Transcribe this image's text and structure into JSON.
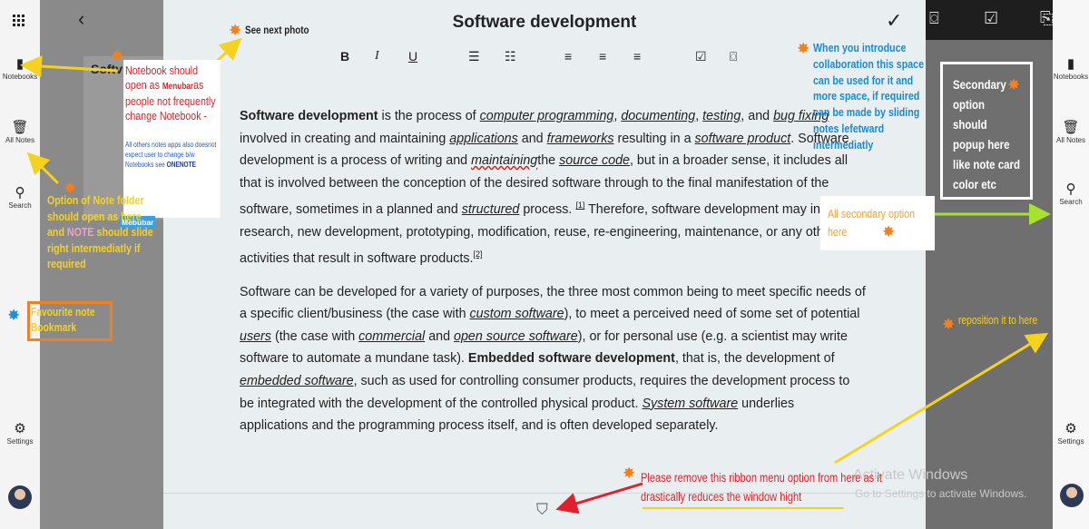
{
  "left_rail": {
    "items": [
      {
        "label": "Notebooks",
        "icon": "notebook-icon"
      },
      {
        "label": "All Notes",
        "icon": "trash-icon"
      },
      {
        "label": "Search",
        "icon": "search-icon"
      },
      {
        "label": "Settings",
        "icon": "gear-icon"
      }
    ]
  },
  "right_rail": {
    "items": [
      {
        "label": "Notebooks"
      },
      {
        "label": "All Notes"
      },
      {
        "label": "Search"
      },
      {
        "label": "Settings"
      }
    ]
  },
  "sidebar": {
    "partial_title": "Softv"
  },
  "editor": {
    "title": "Software development",
    "toolbar": [
      "B",
      "I",
      "U"
    ]
  },
  "content": {
    "p1": {
      "a": "Software development",
      "b": " is the process of ",
      "l1": "computer programming",
      "c": ", ",
      "l2": "documenting",
      "d": ", ",
      "l3": "testing",
      "e": ", and ",
      "l4": "bug fixing",
      "f": " involved in creating and maintaining ",
      "l5": "applications",
      "g": " and ",
      "l6": "frameworks",
      "h": " resulting in a ",
      "l7": "software product",
      "i": ". Software development is a process of writing and ",
      "l8": "maintaining",
      "j": "the ",
      "l9": "source code",
      "k": ", but in a broader sense, it includes all that is involved between the conception of the desired software through to the final manifestation of the software, sometimes in a planned and ",
      "l10": "structured",
      "m": " process. ",
      "ref1": "[1]",
      "n": " Therefore, software development may include research, new development, prototyping, modification, reuse, re-engineering, maintenance, or any other activities that result in software products.",
      "ref2": "[2]"
    },
    "p2": {
      "a": "Software can be developed for a variety of purposes, the three most common being to meet specific needs of a specific client/business (the case with ",
      "l1": "custom software",
      "b": "), to meet a perceived need of some set of potential ",
      "l2": "users",
      "c": " (the case with ",
      "l3": "commercial",
      "d": " and ",
      "l4": "open source software",
      "e": "), or for personal use (e.g. a scientist may write software to automate a mundane task). ",
      "bold": "Embedded software development",
      "f": ", that is, the development of ",
      "l5": "embedded software",
      "g": ", such as used for controlling consumer products, requires the development process to be integrated with the development of the controlled physical product. ",
      "l6": "System software",
      "h": " underlies applications and the programming process itself, and is often developed separately."
    }
  },
  "watermark": {
    "line1": "Activate Windows",
    "line2": "Go to Settings to activate Windows."
  },
  "annotations": {
    "see_next": "See next photo",
    "notebook_note": "Notebook should open as",
    "menubar": "Menubar",
    "notebook_note2": "as people not frequently change Notebook -",
    "small_note": "All others notes apps also doesnot expect user to change b/w Notebooks see",
    "onenote": "ONENOTE",
    "mebubar": "Mebubar",
    "folder_note_a": "Option of Note folder should open as here and",
    "folder_note_note": "NOTE",
    "folder_note_b": "should slide right intermediatly if required",
    "favourite": "Favourite note Bookmark",
    "collab": "When you introduce collaboration this space can be used for it and more space, if required can be made by sliding notes lefetward intermediatly",
    "secondary_popup": "Secondary option should popup here like note card color etc",
    "all_secondary": "All secondary option here",
    "reposition": "reposition it to here",
    "remove_ribbon": "Please remove this ribbon menu option from here as it drastically reduces the window hight"
  },
  "colors": {
    "anno_red": "#e0202a",
    "anno_blue": "#1a8ad0",
    "anno_yellow": "#f5d21e",
    "anno_green": "#a6e22e",
    "anno_orange": "#f08020",
    "anno_pink": "#f0a0c8"
  }
}
